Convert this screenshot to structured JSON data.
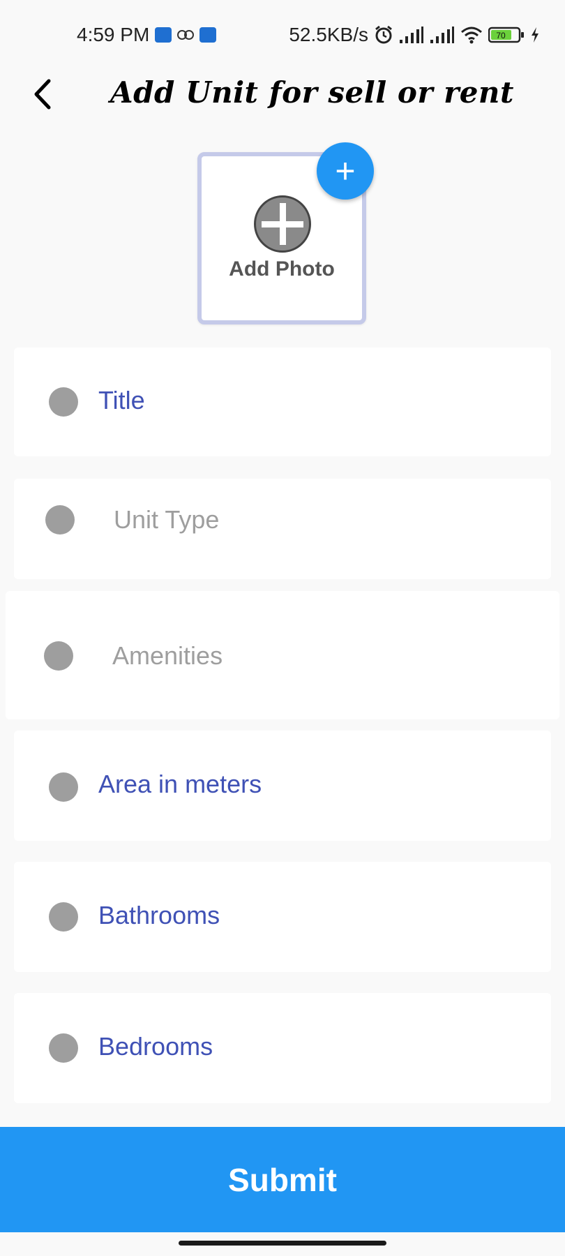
{
  "status_bar": {
    "time": "4:59 PM",
    "network_speed": "52.5KB/s",
    "battery_level": "70",
    "notification_icons": [
      "app-notification-icon",
      "owl-notification-icon",
      "app-notification-icon"
    ],
    "system_icons": [
      "alarm-icon",
      "signal-icon",
      "signal-icon",
      "wifi-icon",
      "battery-icon",
      "charging-icon"
    ]
  },
  "header": {
    "back_icon": "chevron-left-icon",
    "title": "Add Unit for sell or rent"
  },
  "photo": {
    "label": "Add Photo",
    "add_icon": "plus-circle-icon",
    "fab_icon": "plus-icon",
    "fab_symbol": "+"
  },
  "form": {
    "fields": [
      {
        "label": "Title",
        "is_placeholder": false
      },
      {
        "label": "Unit Type",
        "is_placeholder": true
      },
      {
        "label": "Amenities",
        "is_placeholder": true
      },
      {
        "label": "Area in meters",
        "is_placeholder": false
      },
      {
        "label": "Bathrooms",
        "is_placeholder": false
      },
      {
        "label": "Bedrooms",
        "is_placeholder": false
      }
    ]
  },
  "actions": {
    "submit_label": "Submit"
  },
  "colors": {
    "accent": "#2196f3",
    "label": "#3f51b5",
    "placeholder": "#9e9e9e",
    "card_border": "#c5cae9",
    "background": "#f9f9f9"
  }
}
